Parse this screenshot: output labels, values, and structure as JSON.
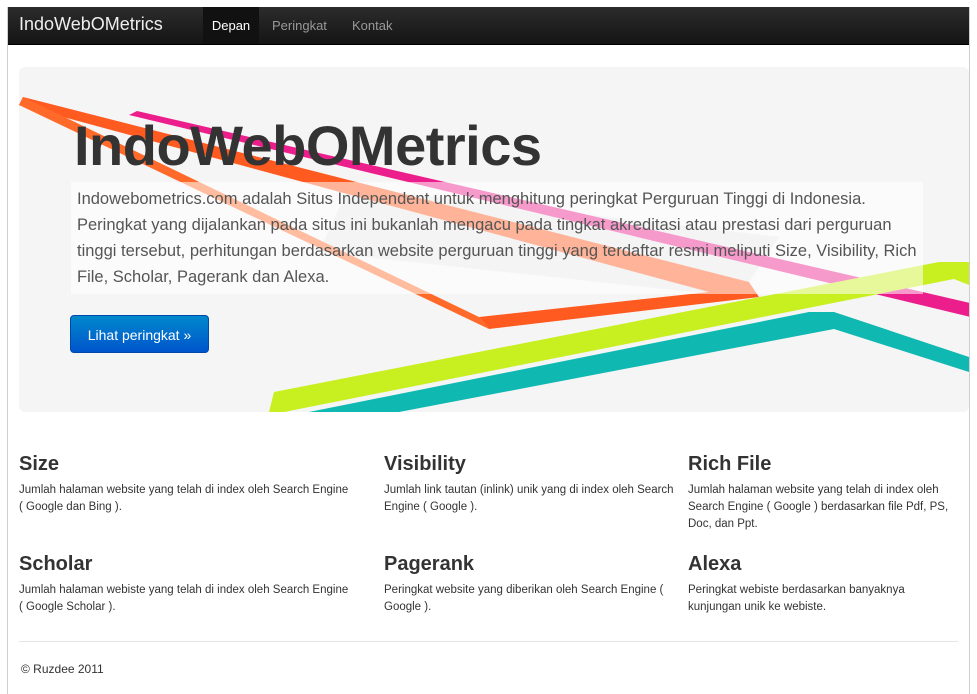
{
  "navbar": {
    "brand": "IndoWebOMetrics",
    "items": [
      {
        "label": "Depan"
      },
      {
        "label": "Peringkat"
      },
      {
        "label": "Kontak"
      }
    ]
  },
  "hero": {
    "title": "IndoWebOMetrics",
    "text": "Indowebometrics.com adalah Situs Independent untuk menghitung peringkat Perguruan Tinggi di Indonesia. Peringkat yang dijalankan pada situs ini bukanlah mengacu pada tingkat akreditasi atau prestasi dari perguruan tinggi tersebut, perhitungan berdasarkan website perguruan tinggi yang terdaftar resmi meliputi Size, Visibility, Rich File, Scholar, Pagerank dan Alexa.",
    "button_label": "Lihat peringkat »",
    "colors": {
      "button": "#0074cc",
      "stripe_orange": "#ff5a1f",
      "stripe_pink": "#ec1e8c",
      "stripe_lime": "#c8ef20",
      "stripe_teal": "#10b8b2"
    }
  },
  "features": [
    {
      "title": "Size",
      "desc": "Jumlah halaman website yang telah di index oleh Search Engine ( Google dan Bing )."
    },
    {
      "title": "Visibility",
      "desc": "Jumlah link tautan (inlink) unik yang di index oleh Search Engine ( Google )."
    },
    {
      "title": "Rich File",
      "desc": "Jumlah halaman website yang telah di index oleh Search Engine ( Google ) berdasarkan file Pdf, PS, Doc, dan Ppt."
    },
    {
      "title": "Scholar",
      "desc": "Jumlah halaman webiste yang telah di index oleh Search Engine ( Google Scholar )."
    },
    {
      "title": "Pagerank",
      "desc": "Peringkat website yang diberikan oleh Search Engine ( Google )."
    },
    {
      "title": "Alexa",
      "desc": "Peringkat webiste berdasarkan banyaknya kunjungan unik ke webiste."
    }
  ],
  "footer": {
    "text": "© Ruzdee 2011"
  }
}
